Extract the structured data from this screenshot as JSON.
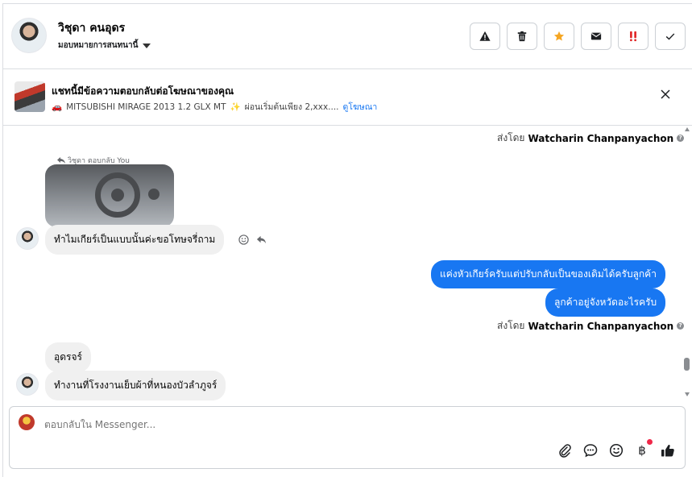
{
  "header": {
    "contact_name": "วิชุดา คนอุดร",
    "assign_label": "มอบหมายการสนทนานี้",
    "actions": [
      {
        "name": "report",
        "icon": "warning-icon"
      },
      {
        "name": "delete",
        "icon": "trash-icon"
      },
      {
        "name": "star",
        "icon": "star-icon",
        "color": "#f5a623"
      },
      {
        "name": "mark-unread",
        "icon": "envelope-icon"
      },
      {
        "name": "mark-important",
        "icon": "double-exclamation-icon",
        "color": "#e02424"
      },
      {
        "name": "done",
        "icon": "check-icon"
      }
    ]
  },
  "ad_banner": {
    "title": "แชทนี้มีข้อความตอบกลับต่อโฆษณาของคุณ",
    "car_emoji": "🚗",
    "ad_text": "MITSUBISHI MIRAGE 2013 1.2 GLX MT",
    "sparkle_emoji": "✨",
    "ad_text_2": "ผ่อนเริ่มต้นเพียง 2,xxx....",
    "link_label": "ดูโฆษณา"
  },
  "messages": {
    "sent_by_prefix": "ส่งโดย",
    "agent_name": "Watcharin Chanpanyachon",
    "info_glyph": "?",
    "reply_hint": "วิชุดา ตอบกลับ You",
    "in_1": "ทำไมเกียร์เป็นแบบนั้นค่ะขอโทษจรี่ถาม",
    "out_1": "แค่งหัวเกียร์ครับแต่ปรับกลับเป็นของเดิมได้ครับลูกค้า",
    "out_2": "ลูกค้าอยู่จังหวัดอะไรครับ",
    "in_2": "อุดรจร์",
    "in_3": "ทำงานที่โรงงานเย็บผ้าที่หนองบัวลำภูจร์"
  },
  "composer": {
    "placeholder": "ตอบกลับใน Messenger...",
    "tools": [
      "paperclip-icon",
      "chat-bubble-icon",
      "smiley-icon",
      "baht-icon",
      "thumbs-up-icon"
    ],
    "baht_glyph": "฿"
  },
  "colors": {
    "accent": "#1877f2",
    "incoming_bubble": "#f0f0f0",
    "notification": "#f02849"
  }
}
